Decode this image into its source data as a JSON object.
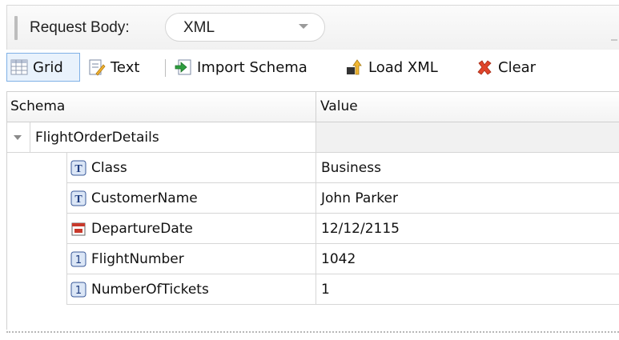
{
  "request_body": {
    "label": "Request Body:",
    "format_value": "XML"
  },
  "toolbar": {
    "grid_label": "Grid",
    "text_label": "Text",
    "import_label": "Import Schema",
    "load_label": "Load XML",
    "clear_label": "Clear"
  },
  "grid": {
    "columns": [
      "Schema",
      "Value"
    ],
    "parent": {
      "name": "FlightOrderDetails",
      "value": ""
    },
    "rows": [
      {
        "type": "text-type-icon",
        "name": "Class",
        "value": "Business"
      },
      {
        "type": "text-type-icon",
        "name": "CustomerName",
        "value": "John Parker"
      },
      {
        "type": "date-type-icon",
        "name": "DepartureDate",
        "value": "12/12/2115"
      },
      {
        "type": "number-type-icon",
        "name": "FlightNumber",
        "value": "1042"
      },
      {
        "type": "number-type-icon",
        "name": "NumberOfTickets",
        "value": "1"
      }
    ]
  }
}
